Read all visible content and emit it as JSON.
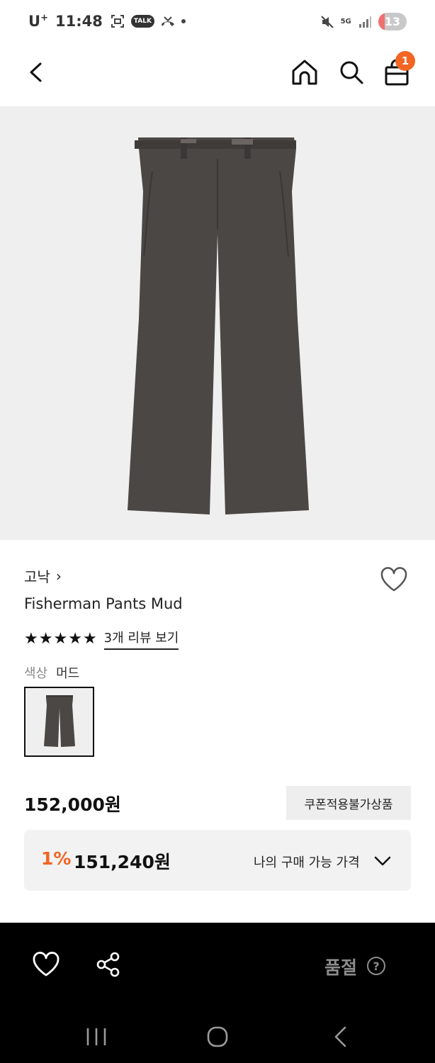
{
  "status_bar": {
    "carrier": "U",
    "carrier_sup": "+",
    "time": "11:48",
    "talk_badge": "TALK",
    "network": "5G",
    "battery": "13"
  },
  "header": {
    "cart_count": "1"
  },
  "product": {
    "brand": "고낙",
    "brand_chevron": "›",
    "name": "Fisherman Pants Mud",
    "rating_stars": 5,
    "review_link": "3개 리뷰 보기",
    "color_label": "색상",
    "color_value": "머드",
    "price": "152,000원",
    "coupon_notice": "쿠폰적용불가상품",
    "my_discount_rate": "1%",
    "my_price": "151,240원",
    "my_price_label": "나의 구매 가능 가격"
  },
  "bottom_bar": {
    "status": "품절",
    "help": "?"
  },
  "icons": {
    "back": "chevron-left-icon",
    "home": "home-icon",
    "search": "search-icon",
    "cart": "shopping-bag-icon",
    "wish": "heart-icon",
    "share": "share-icon",
    "expand": "chevron-down-icon"
  },
  "colors": {
    "accent": "#f26522",
    "bottom_bar_bg": "#000000",
    "disabled_text": "#8c8c8c",
    "image_bg": "#efefef",
    "pants": "#4a4745"
  }
}
